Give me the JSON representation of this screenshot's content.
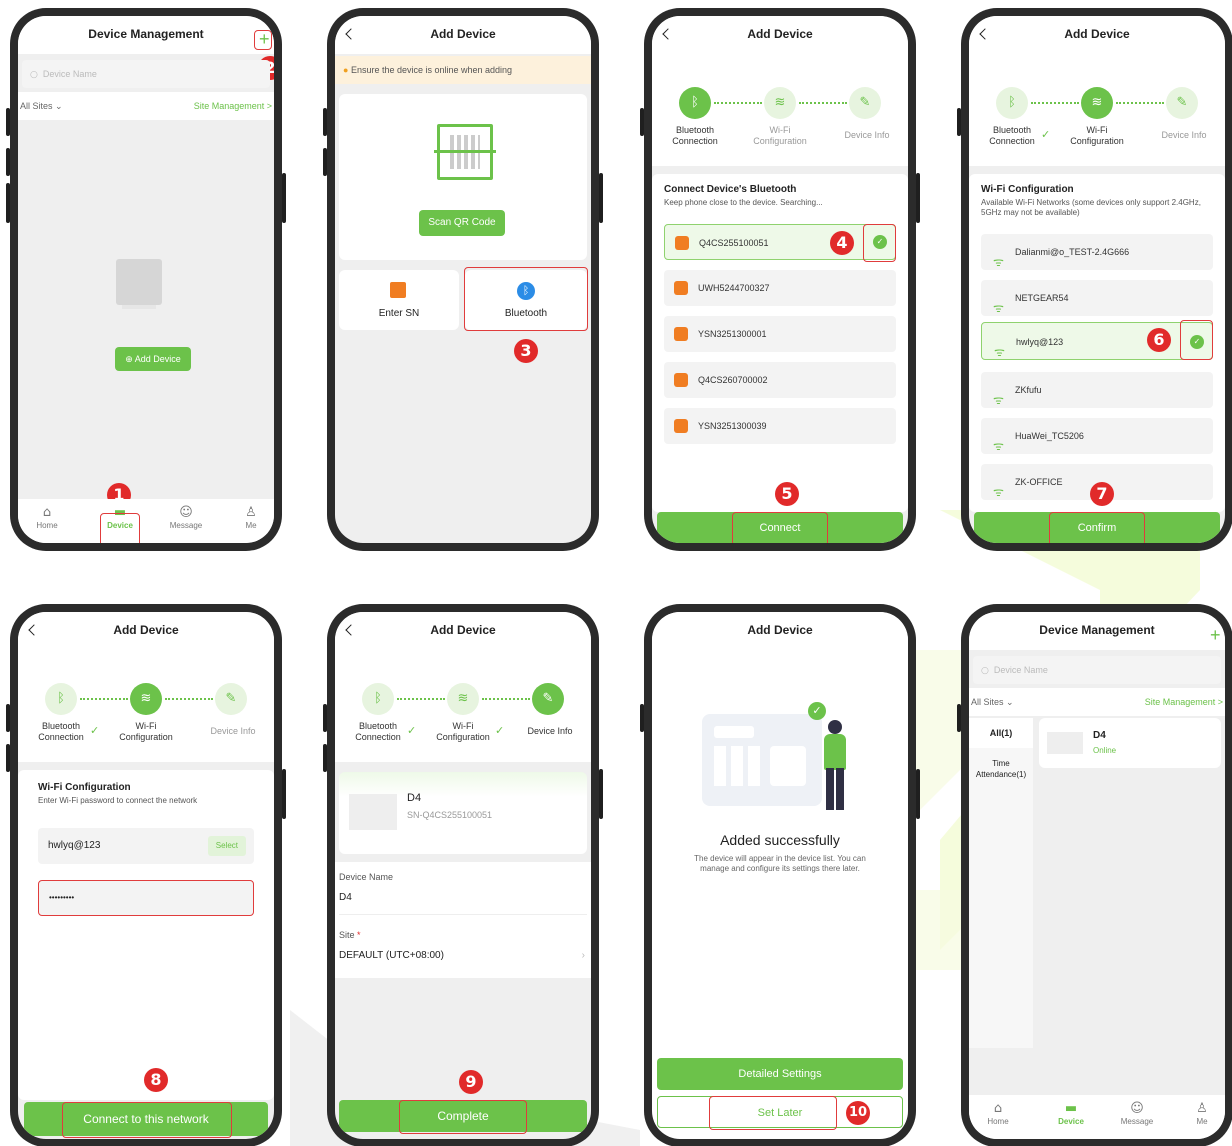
{
  "colors": {
    "accent": "#6cc24a",
    "marker": "#e12a2a",
    "screen_bg": "#efefef"
  },
  "steps": {
    "bluetooth": "Bluetooth\nConnection",
    "wifi": "Wi-Fi\nConfiguration",
    "info": "Device Info"
  },
  "markers": [
    "1",
    "2",
    "3",
    "4",
    "5",
    "6",
    "7",
    "8",
    "9",
    "10"
  ],
  "p1": {
    "title": "Device Management",
    "search_placeholder": "Device Name",
    "sites": "All Sites",
    "site_mgmt": "Site Management >",
    "add_device": "Add Device",
    "tabs": [
      "Home",
      "Device",
      "Message",
      "Me"
    ]
  },
  "p2": {
    "title": "Add Device",
    "notice": "Ensure the device is online when adding",
    "scan": "Scan QR Code",
    "enter_sn": "Enter SN",
    "bluetooth": "Bluetooth"
  },
  "p3": {
    "title": "Add Device",
    "section_title": "Connect Device's Bluetooth",
    "section_sub": "Keep phone close to the device. Searching...",
    "devices": [
      "Q4CS255100051",
      "UWH5244700327",
      "YSN3251300001",
      "Q4CS260700002",
      "YSN3251300039"
    ],
    "connect": "Connect"
  },
  "p4": {
    "title": "Add Device",
    "section_title": "Wi-Fi Configuration",
    "section_sub": "Available Wi-Fi Networks (some devices only support 2.4GHz, 5GHz may not be available)",
    "networks": [
      "Dalianmi@o_TEST-2.4G666",
      "NETGEAR54",
      "hwlyq@123",
      "ZKfufu",
      "HuaWei_TC5206",
      "ZK-OFFICE"
    ],
    "confirm": "Confirm"
  },
  "p5": {
    "title": "Add Device",
    "section_title": "Wi-Fi Configuration",
    "section_sub": "Enter Wi-Fi password to connect the network",
    "ssid": "hwlyq@123",
    "select": "Select",
    "password": "•••••••••",
    "connect": "Connect to this network"
  },
  "p6": {
    "title": "Add Device",
    "device_name": "D4",
    "serial": "SN-Q4CS255100051",
    "name_label": "Device Name",
    "name_value": "D4",
    "site_label": "Site",
    "site_value": "DEFAULT (UTC+08:00)",
    "complete": "Complete"
  },
  "p7": {
    "title": "Add Device",
    "success": "Added successfully",
    "desc": "The device will appear in the device list. You can manage and configure its settings there later.",
    "detailed": "Detailed Settings",
    "later": "Set Later"
  },
  "p8": {
    "title": "Device Management",
    "search_placeholder": "Device Name",
    "sites": "All Sites",
    "site_mgmt": "Site Management >",
    "all": "All(1)",
    "time_att": "Time\nAttendance(1)",
    "device": "D4",
    "status": "Online",
    "tabs": [
      "Home",
      "Device",
      "Message",
      "Me"
    ]
  }
}
